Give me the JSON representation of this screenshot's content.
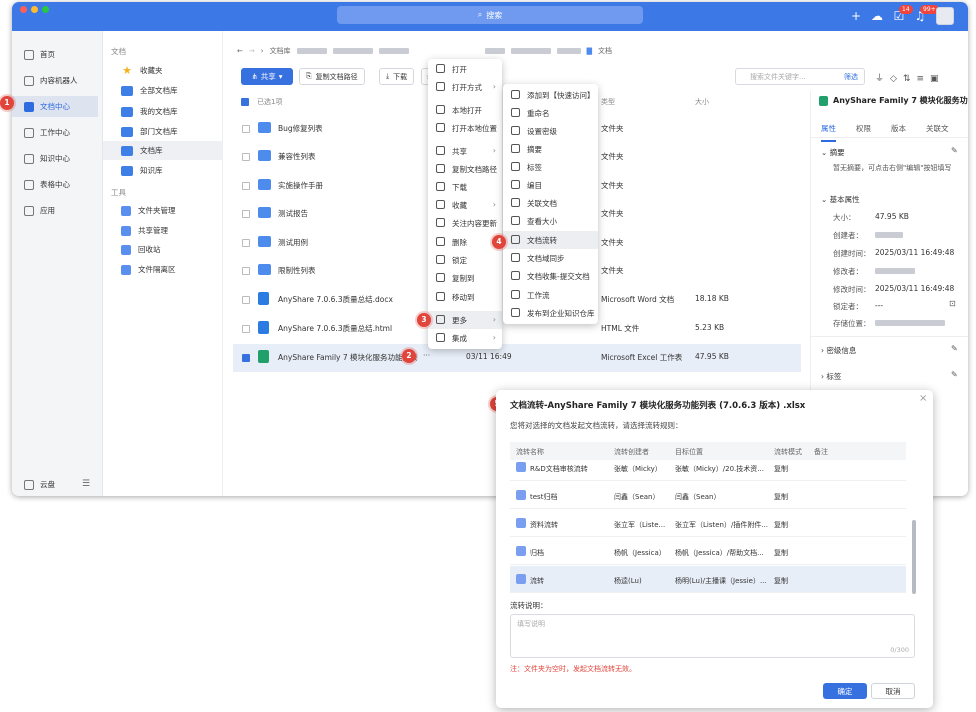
{
  "topbar": {
    "search_label": "搜索",
    "badge_tasks": "14",
    "badge_notifications": "99+"
  },
  "nav1": [
    "首页",
    "内容机器人",
    "文档中心",
    "工作中心",
    "知识中心",
    "表格中心",
    "应用"
  ],
  "nav1_footer": "云盘",
  "nav2": {
    "docs_header": "文档",
    "docs": [
      "收藏夹",
      "全部文档库",
      "我的文档库",
      "部门文档库",
      "文档库",
      "知识库"
    ],
    "tools_header": "工具",
    "tools": [
      "文件夹管理",
      "共享管理",
      "回收站",
      "文件隔离区"
    ]
  },
  "breadcrumb": {
    "lib": "文档库",
    "last": "文档"
  },
  "toolbar": {
    "share": "共享",
    "copy_path": "复制文档路径",
    "download": "下载"
  },
  "search": {
    "placeholder": "搜索文件关键字...",
    "filter": "筛选"
  },
  "table": {
    "selected": "已选1项",
    "col_type": "类型",
    "col_size": "大小",
    "rows": [
      {
        "name": "Bug修复列表",
        "date": "",
        "type": "文件夹",
        "size": ""
      },
      {
        "name": "兼容性列表",
        "date": "",
        "type": "文件夹",
        "size": ""
      },
      {
        "name": "实施操作手册",
        "date": "",
        "type": "文件夹",
        "size": ""
      },
      {
        "name": "测试报告",
        "date": "",
        "type": "文件夹",
        "size": ""
      },
      {
        "name": "测试用例",
        "date": "",
        "type": "文件夹",
        "size": ""
      },
      {
        "name": "限制性列表",
        "date": "",
        "type": "文件夹",
        "size": ""
      },
      {
        "name": "AnyShare 7.0.6.3质量总结.docx",
        "date": "",
        "type": "Microsoft Word 文档",
        "size": "18.18 KB"
      },
      {
        "name": "AnyShare 7.0.6.3质量总结.html",
        "date": "",
        "type": "HTML 文件",
        "size": "5.23 KB"
      },
      {
        "name": "AnyShare Family 7 模块化服务功能列表",
        "date": "03/11 16:49",
        "type": "Microsoft Excel 工作表",
        "size": "47.95 KB"
      }
    ]
  },
  "detail": {
    "title": "AnyShare Family 7 模块化服务功能...",
    "tabs": [
      "属性",
      "权限",
      "版本",
      "关联文"
    ],
    "summary_header": "摘要",
    "summary_text": "暂无摘要，可点击右侧\"编辑\"按钮填写",
    "basic_header": "基本属性",
    "size_label": "大小：",
    "size_value": "47.95 KB",
    "creator_label": "创建者：",
    "created_label": "创建时间：",
    "created_value": "2025/03/11 16:49:48",
    "modifier_label": "修改者：",
    "modified_label": "修改时间：",
    "modified_value": "2025/03/11 16:49:48",
    "locker_label": "锁定者：",
    "locker_value": "---",
    "location_label": "存储位置：",
    "section_tags": "标签",
    "section_more": "密级信息"
  },
  "context_menu": {
    "items": [
      "打开",
      "打开方式",
      "本地打开",
      "打开本地位置",
      "共享",
      "复制文档路径",
      "下载",
      "收藏",
      "关注内容更新",
      "删除",
      "锁定",
      "复制到",
      "移动到",
      "更多",
      "集成"
    ]
  },
  "submenu": {
    "items": [
      "添加到【快速访问】",
      "重命名",
      "设置密级",
      "摘要",
      "标签",
      "编目",
      "关联文档",
      "查看大小",
      "文档流转",
      "文档域同步",
      "文档收集-提交文档",
      "工作流",
      "发布到企业知识仓库"
    ]
  },
  "steps": [
    "1",
    "2",
    "3",
    "4",
    "5"
  ],
  "dialog": {
    "title": "文档流转-AnyShare Family 7 模块化服务功能列表 (7.0.6.3 版本) .xlsx",
    "subtitle": "您将对选择的文档发起文档流转，请选择流转规则：",
    "headers": [
      "流转名称",
      "流转创建者",
      "目标位置",
      "流转模式",
      "备注"
    ],
    "rows": [
      {
        "name": "R&D文档审核流转",
        "creator": "张敏（Micky）",
        "target": "张敏（Micky）/20.技术资...",
        "mode": "复制"
      },
      {
        "name": "test归档",
        "creator": "闫鑫（Sean）",
        "target": "闫鑫（Sean）",
        "mode": "复制"
      },
      {
        "name": "资料流转",
        "creator": "张立军（Liste...",
        "target": "张立军（Listen）/插件附件...",
        "mode": "复制"
      },
      {
        "name": "归档",
        "creator": "杨帆（Jessica）",
        "target": "杨帆（Jessica）/帮助文档...",
        "mode": "复制"
      },
      {
        "name": "流转",
        "creator": "杨逵(Lu)",
        "target": "杨明(Lu)/主播课（Jessie）...",
        "mode": "复制"
      }
    ],
    "note_label": "流转说明：",
    "note_placeholder": "填写说明",
    "counter": "0/300",
    "warning": "注：文件夹为空时，发起文档流转无效。",
    "ok": "确定",
    "cancel": "取消"
  }
}
